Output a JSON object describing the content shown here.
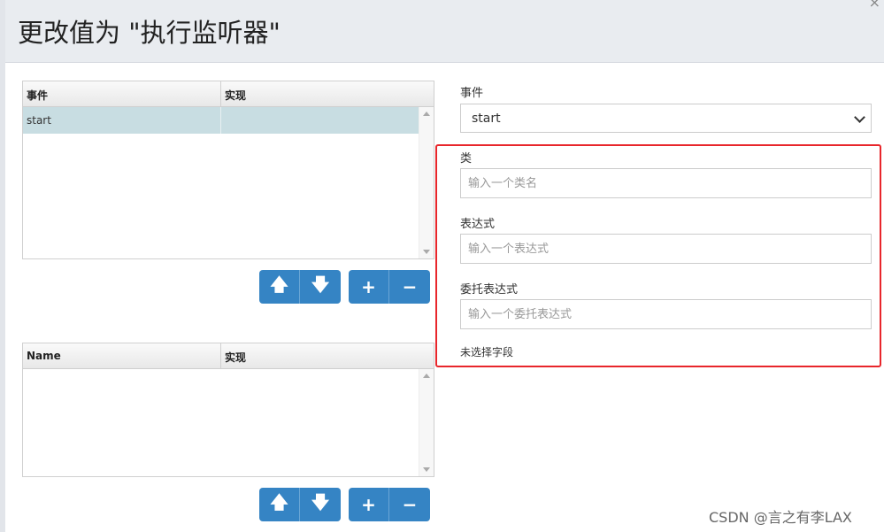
{
  "dialog": {
    "title": "更改值为 \"执行监听器\"",
    "close_glyph": "×"
  },
  "listeners_grid": {
    "columns": [
      "事件",
      "实现"
    ],
    "rows": [
      {
        "event": "start",
        "implementation": ""
      }
    ]
  },
  "fields_grid": {
    "columns": [
      "Name",
      "实现"
    ],
    "rows": []
  },
  "buttons": {
    "move_up": "🡅",
    "move_down": "🡇",
    "add": "+",
    "remove": "−"
  },
  "form": {
    "event_label": "事件",
    "event_value": "start",
    "class_label": "类",
    "class_placeholder": "输入一个类名",
    "expression_label": "表达式",
    "expression_placeholder": "输入一个表达式",
    "delegate_label": "委托表达式",
    "delegate_placeholder": "输入一个委托表达式",
    "no_field_text": "未选择字段"
  },
  "watermark": "CSDN @言之有李LAX",
  "colors": {
    "accent": "#3584c4",
    "selection": "#c8dde2",
    "highlight_border": "#e8262b"
  }
}
